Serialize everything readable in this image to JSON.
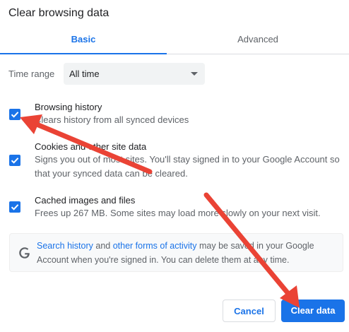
{
  "dialog": {
    "title": "Clear browsing data"
  },
  "tabs": [
    {
      "label": "Basic",
      "selected": true
    },
    {
      "label": "Advanced",
      "selected": false
    }
  ],
  "time_range": {
    "label": "Time range",
    "value": "All time"
  },
  "options": [
    {
      "title": "Browsing history",
      "description": "Clears history from all synced devices",
      "checked": true
    },
    {
      "title": "Cookies and other site data",
      "description": "Signs you out of most sites. You'll stay signed in to your Google Account so that your synced data can be cleared.",
      "checked": true
    },
    {
      "title": "Cached images and files",
      "description": "Frees up 267 MB. Some sites may load more slowly on your next visit.",
      "checked": true
    }
  ],
  "info": {
    "link1": "Search history",
    "text1": " and ",
    "link2": "other forms of activity",
    "text2": " may be saved in your Google Account when you're signed in. You can delete them at any time."
  },
  "buttons": {
    "cancel": "Cancel",
    "clear": "Clear data"
  },
  "colors": {
    "accent": "#1a73e8",
    "annotation_arrow": "#ea4335"
  },
  "icons": {
    "info": "google-g-icon",
    "dropdown": "chevron-down-icon",
    "checkbox": "checkmark-icon"
  }
}
